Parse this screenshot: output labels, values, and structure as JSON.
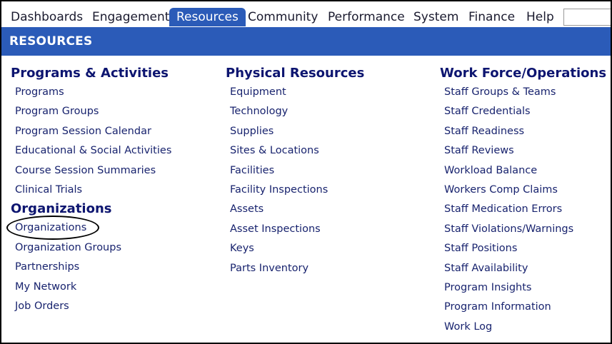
{
  "nav": {
    "tabs": [
      {
        "label": "Dashboards"
      },
      {
        "label": "Engagement"
      },
      {
        "label": "Resources"
      },
      {
        "label": "Community"
      },
      {
        "label": "Performance"
      },
      {
        "label": "System"
      },
      {
        "label": "Finance"
      },
      {
        "label": "Help"
      }
    ],
    "active_tab": "Resources",
    "search_value": ""
  },
  "banner": {
    "title": "RESOURCES"
  },
  "columns": [
    {
      "sections": [
        {
          "title": "Programs & Activities",
          "links": [
            "Programs",
            "Program Groups",
            "Program Session Calendar",
            "Educational & Social Activities",
            "Course Session Summaries",
            "Clinical Trials"
          ]
        },
        {
          "title": "Organizations",
          "links": [
            "Organizations",
            "Organization Groups",
            "Partnerships",
            "My Network",
            "Job Orders"
          ]
        }
      ]
    },
    {
      "sections": [
        {
          "title": "Physical Resources",
          "links": [
            "Equipment",
            "Technology",
            "Supplies",
            "Sites & Locations",
            "Facilities",
            "Facility Inspections",
            "Assets",
            "Asset Inspections",
            "Keys",
            "Parts Inventory"
          ]
        }
      ]
    },
    {
      "sections": [
        {
          "title": "Work Force/Operations",
          "links": [
            "Staff Groups & Teams",
            "Staff Credentials",
            "Staff Readiness",
            "Staff Reviews",
            "Workload Balance",
            "Workers Comp Claims",
            "Staff Medication Errors",
            "Staff Violations/Warnings",
            "Staff Positions",
            "Staff Availability",
            "Program Insights",
            "Program Information",
            "Work Log"
          ]
        }
      ]
    }
  ],
  "colors": {
    "nav_active": "#2b5bb8",
    "banner": "#2b5bb8",
    "heading": "#0d1570",
    "link": "#18236e"
  }
}
